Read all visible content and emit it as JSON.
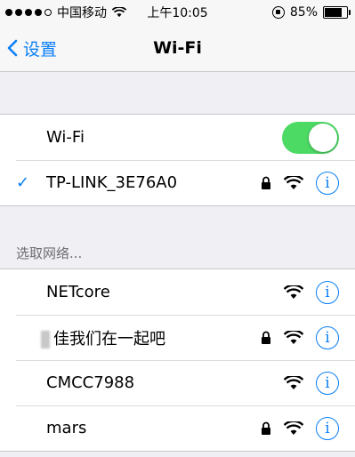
{
  "status_bar": {
    "carrier": "中国移动",
    "time": "上午10:05",
    "battery": "85%",
    "battery_level": 0.85
  },
  "nav": {
    "back_label": "设置",
    "title": "Wi-Fi"
  },
  "wifi_toggle": {
    "label": "Wi-Fi",
    "on": true
  },
  "connected": {
    "name": "TP-LINK_3E76A0",
    "locked": true
  },
  "section_header": "选取网络...",
  "networks": [
    {
      "name": "NETcore",
      "locked": false
    },
    {
      "name": "佳我们在一起吧",
      "locked": true
    },
    {
      "name": "CMCC7988",
      "locked": false
    },
    {
      "name": "mars",
      "locked": true
    }
  ],
  "colors": {
    "accent": "#0a7ff5",
    "toggle_on": "#4cd964"
  },
  "info_glyph": "i",
  "check_glyph": "✓"
}
